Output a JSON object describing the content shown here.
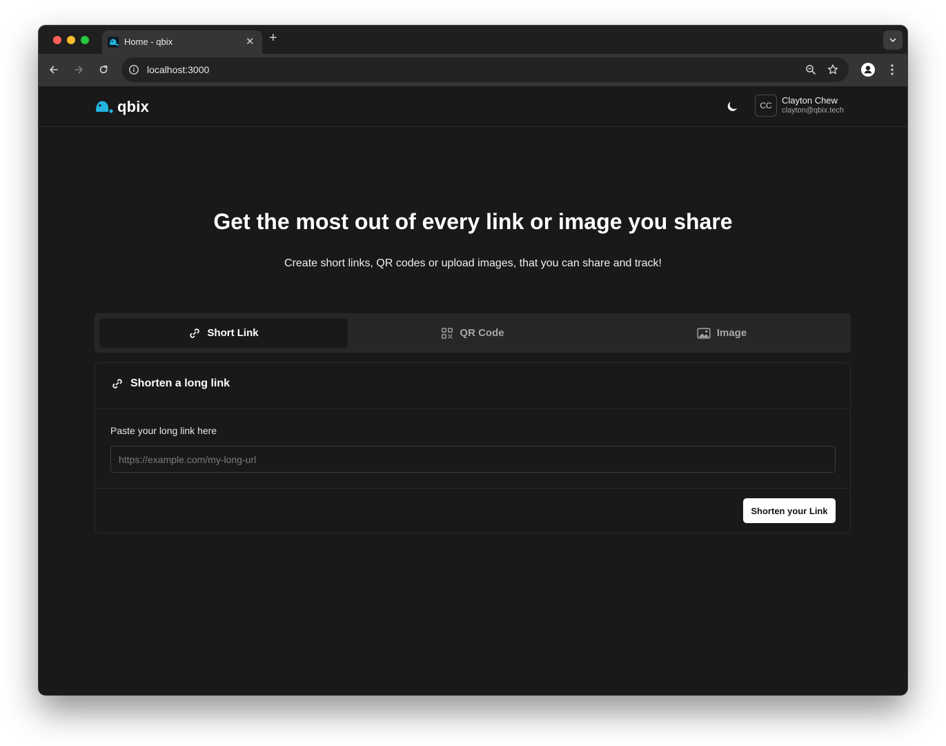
{
  "browser": {
    "tab_title": "Home - qbix",
    "tab_close_icon": "close-icon",
    "new_tab_label": "+",
    "url": "localhost:3000"
  },
  "site": {
    "logo_text": "qbix",
    "brand_color": "#22b5e0",
    "user": {
      "initials": "CC",
      "name": "Clayton Chew",
      "email": "clayton@qbix.tech"
    }
  },
  "hero": {
    "title": "Get the most out of every link or image you share",
    "subtitle": "Create short links, QR codes or upload images, that you can share and track!"
  },
  "tabs": [
    {
      "label": "Short Link",
      "icon": "link-icon",
      "active": true
    },
    {
      "label": "QR Code",
      "icon": "qr-code-icon",
      "active": false
    },
    {
      "label": "Image",
      "icon": "image-icon",
      "active": false
    }
  ],
  "card": {
    "title": "Shorten a long link",
    "field_label": "Paste your long link here",
    "input_value": "",
    "input_placeholder": "https://example.com/my-long-url",
    "submit_label": "Shorten your Link"
  }
}
